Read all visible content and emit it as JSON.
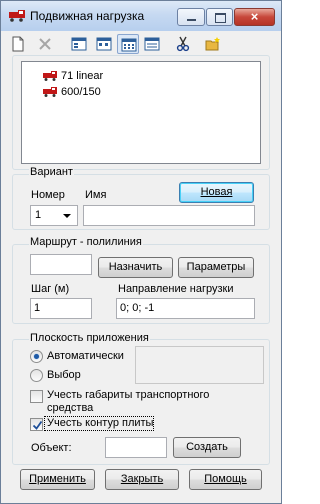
{
  "window": {
    "title": "Подвижная нагрузка",
    "close_glyph": "×"
  },
  "toolbar": {
    "items": [
      "new-icon",
      "delete-icon",
      "view-1-icon",
      "view-2-icon",
      "view-3-icon",
      "view-4-icon",
      "cut-icon",
      "open-folder-icon"
    ]
  },
  "loads": [
    {
      "label": "71 linear"
    },
    {
      "label": "600/150"
    }
  ],
  "variant": {
    "title": "Вариант",
    "number_label": "Номер",
    "name_label": "Имя",
    "number_value": "1",
    "name_value": "",
    "new_button": "Новая"
  },
  "route": {
    "title": "Маршрут - полилиния",
    "polyline_value": "",
    "assign_button": "Назначить",
    "params_button": "Параметры",
    "step_label": "Шаг (м)",
    "step_value": "1",
    "direction_label": "Направление нагрузки",
    "direction_value": "0; 0; -1"
  },
  "plane": {
    "title": "Плоскость приложения",
    "auto_label": "Автоматически",
    "choice_label": "Выбор",
    "dims_label_1": "Учесть габариты транспортного",
    "dims_label_2": "средства",
    "contour_label": "Учесть контур плиты",
    "object_label": "Объект:",
    "object_value": "",
    "create_button": "Создать",
    "auto_selected": true,
    "dims_checked": false,
    "contour_checked": true
  },
  "footer": {
    "apply": "Применить",
    "close": "Закрыть",
    "help": "Помощь"
  },
  "colors": {
    "vehicle_red": "#c01818",
    "accent_blue": "#3c7fb1"
  }
}
